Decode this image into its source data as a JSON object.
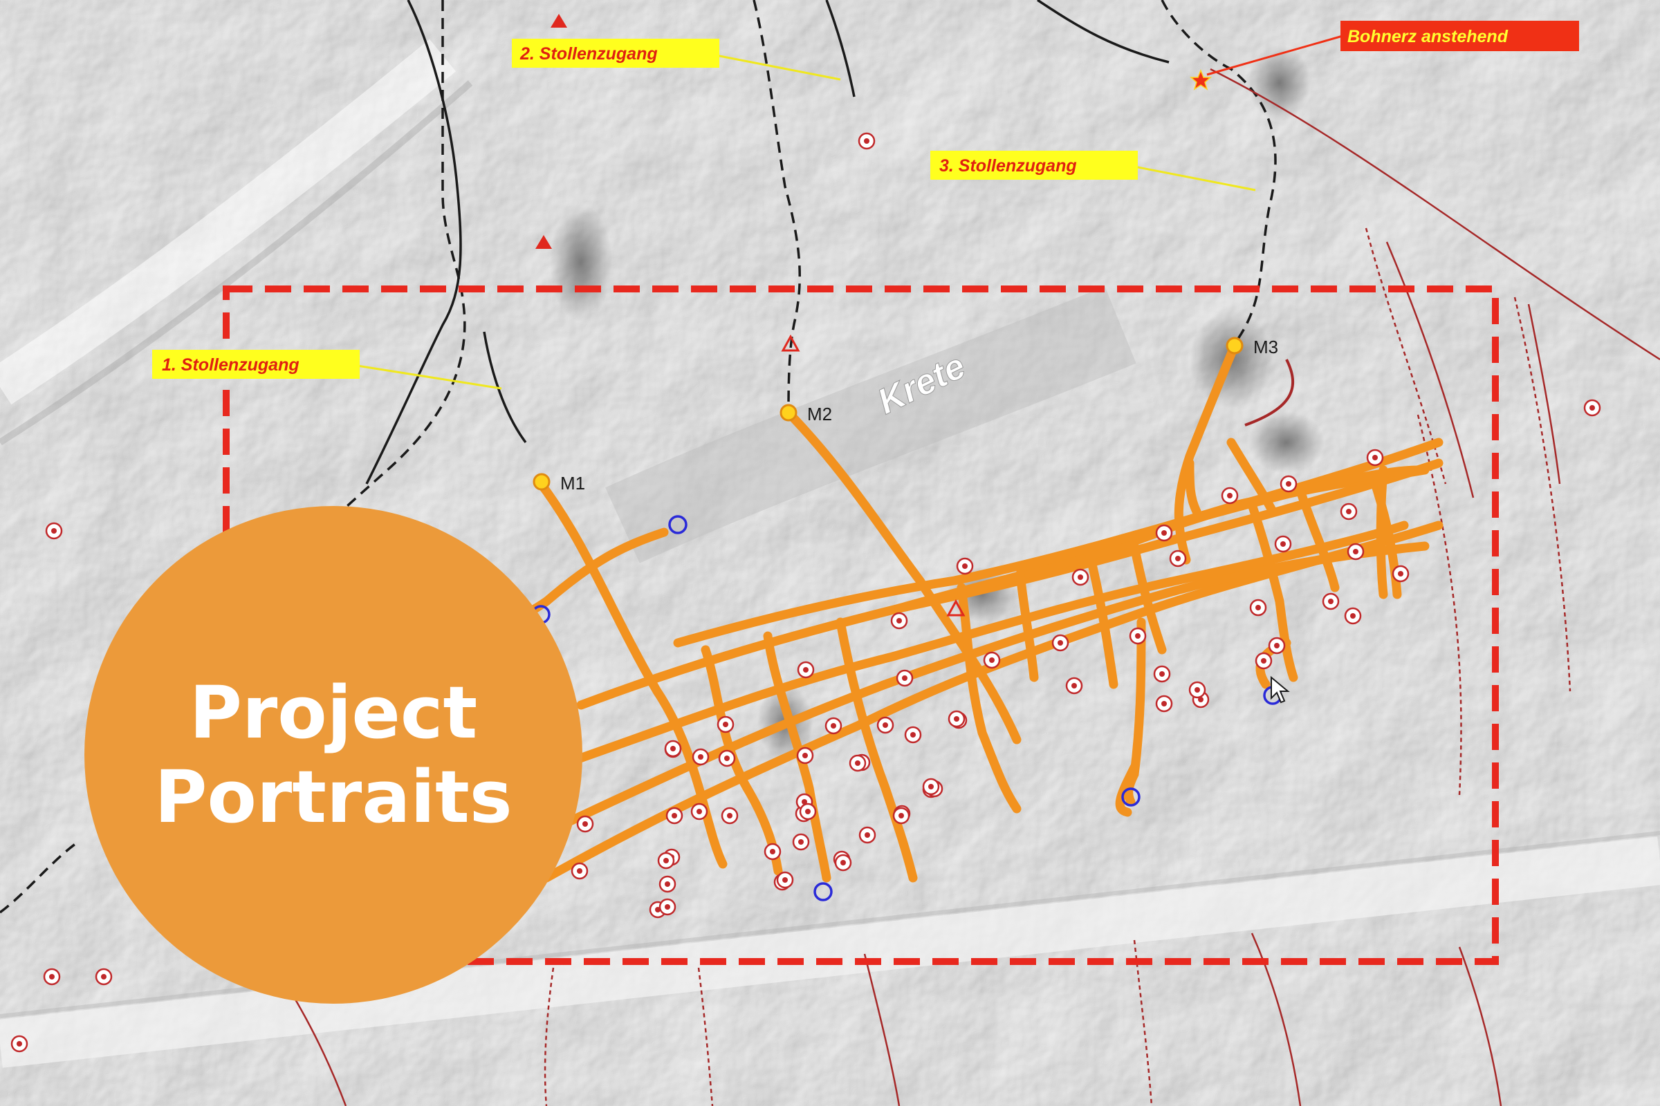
{
  "map": {
    "callouts": [
      {
        "id": "stollenzugang-1",
        "text": "1. Stollenzugang",
        "bg": "#ffff1e",
        "fg": "#e02010"
      },
      {
        "id": "stollenzugang-2",
        "text": "2. Stollenzugang",
        "bg": "#ffff1e",
        "fg": "#e02010"
      },
      {
        "id": "stollenzugang-3",
        "text": "3. Stollenzugang",
        "bg": "#ffff1e",
        "fg": "#e02010"
      },
      {
        "id": "bohnerz",
        "text": "Bohnerz anstehend",
        "bg": "#f03015",
        "fg": "#ffff30"
      }
    ],
    "shaft_labels": [
      "M1",
      "M2",
      "M3"
    ],
    "ridge_label": "Krete",
    "colors": {
      "tunnel": "#f2921f",
      "survey_frame": "#e8281e",
      "marker_red": "#c0282a",
      "marker_blue": "#2a2ad8",
      "path_black": "#1a1a1a",
      "fault_line": "#a62828",
      "shaft_point": "#ffd21e"
    },
    "icons": [
      "map-cursor-icon"
    ]
  },
  "badge": {
    "line1": "Project",
    "line2": "Portraits",
    "color": "#ec9a3a"
  }
}
